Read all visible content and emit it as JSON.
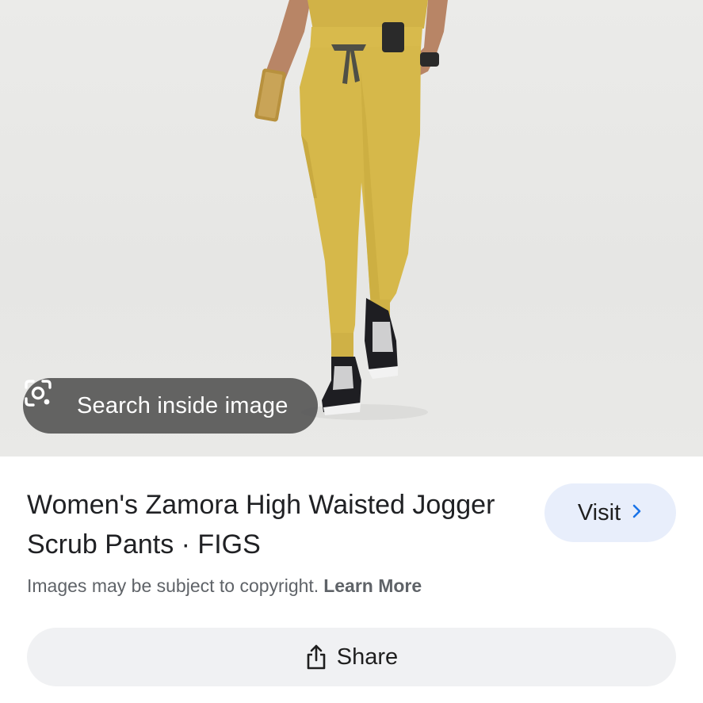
{
  "image_preview": {
    "alt": "",
    "search_inside_label": "Search inside image",
    "search_icon": "google-lens-icon"
  },
  "result": {
    "title": "Women's Zamora High Waisted Jogger Scrub Pants · FIGS",
    "visit_label": "Visit",
    "visit_icon": "chevron-right-icon",
    "copyright_text": "Images may be subject to copyright.",
    "learn_more_label": "Learn More",
    "share_label": "Share",
    "share_icon": "share-icon"
  },
  "colors": {
    "pants": "#d6b84a",
    "visit_button_bg": "#e8eefb",
    "share_button_bg": "#f0f1f3",
    "chip_bg": "#505050"
  }
}
